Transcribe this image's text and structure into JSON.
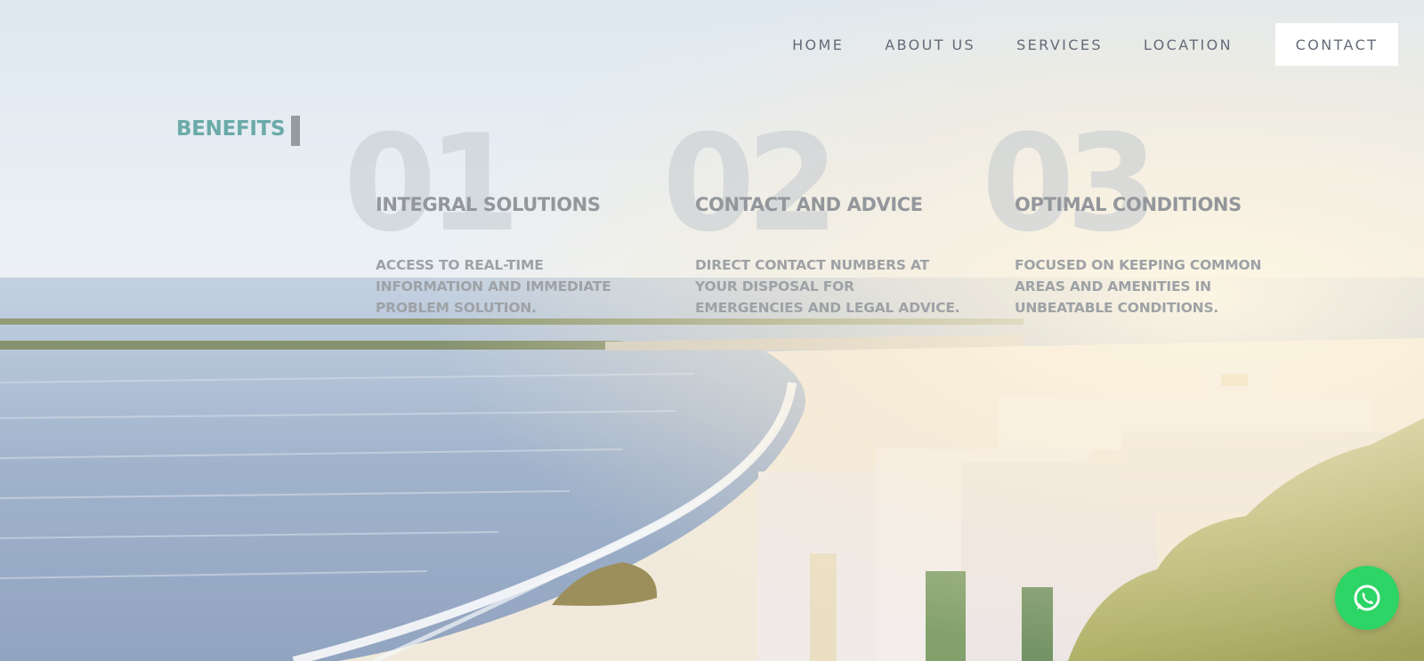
{
  "nav": {
    "home": "HOME",
    "about": "ABOUT US",
    "services": "SERVICES",
    "location": "LOCATION",
    "contact": "CONTACT"
  },
  "benefits": {
    "title": "BENEFITS",
    "items": [
      {
        "number": "01",
        "title": "INTEGRAL SOLUTIONS",
        "description": "ACCESS TO REAL-TIME INFORMATION AND IMMEDIATE PROBLEM SOLUTION."
      },
      {
        "number": "02",
        "title": "CONTACT AND ADVICE",
        "description": "DIRECT CONTACT NUMBERS AT YOUR DISPOSAL FOR EMERGENCIES AND LEGAL ADVICE."
      },
      {
        "number": "03",
        "title": "OPTIMAL CONDITIONS",
        "description": "FOCUSED ON KEEPING COMMON AREAS AND AMENITIES IN UNBEATABLE CONDITIONS."
      }
    ]
  },
  "whatsapp": {
    "icon": "whatsapp-icon",
    "color": "#2dd466"
  },
  "colors": {
    "accent": "#6aaaa8",
    "nav_text": "#646b78"
  }
}
